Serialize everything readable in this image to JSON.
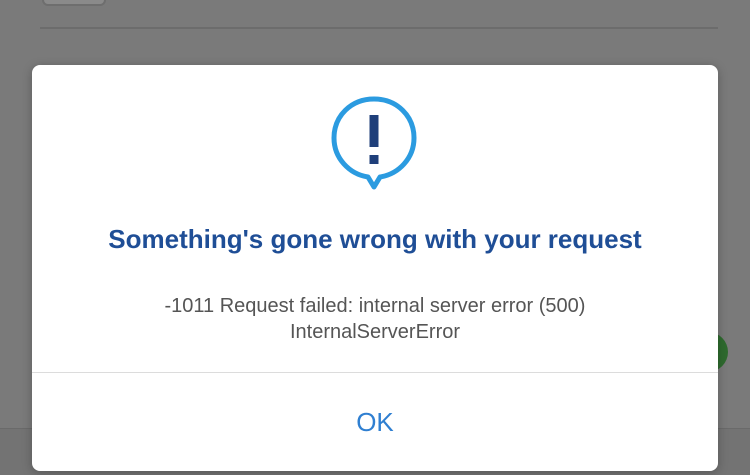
{
  "dialog": {
    "icon": "alert-bubble-icon",
    "title": "Something's gone wrong with your request",
    "message_line1": "-1011 Request failed: internal server error (500)",
    "message_line2": "InternalServerError",
    "ok_label": "OK"
  },
  "colors": {
    "title": "#1f4e96",
    "icon": "#2b9be0",
    "button": "#2f7fd1",
    "overlay": "#7a7a7a"
  }
}
